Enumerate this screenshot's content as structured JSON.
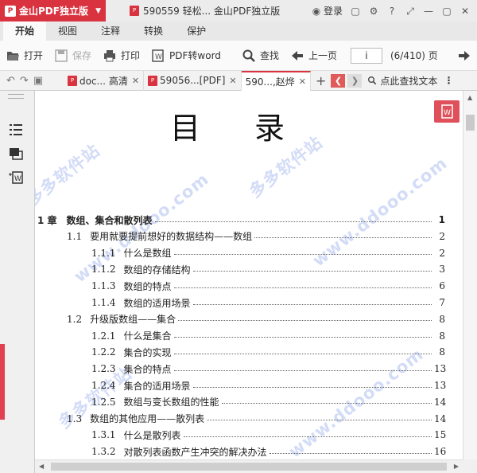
{
  "app": {
    "brand": "金山PDF独立版"
  },
  "window": {
    "title": "590559 轻松... 金山PDF独立版",
    "login": "登录"
  },
  "ribbon": {
    "tabs": [
      "开始",
      "视图",
      "注释",
      "转换",
      "保护"
    ]
  },
  "toolbar": {
    "open": "打开",
    "save": "保存",
    "print": "打印",
    "to_word": "PDF转word",
    "find": "查找",
    "prev_page": "上一页",
    "page_value": "i",
    "page_count": "(6/410)",
    "page_unit": "页"
  },
  "doc_tabs": [
    {
      "label": "doc... 高清"
    },
    {
      "label": "59056...[PDF]"
    },
    {
      "label": "590...,赵烨"
    }
  ],
  "find_text": "点此查找文本",
  "document": {
    "heading": "目录",
    "entries": [
      {
        "num": "1 章",
        "title": "数组、集合和散列表",
        "page": "1",
        "level": 0
      },
      {
        "num": "1.1",
        "title": "要用就要提前想好的数据结构——数组",
        "page": "2",
        "level": 1
      },
      {
        "num": "1.1.1",
        "title": "什么是数组",
        "page": "2",
        "level": 2
      },
      {
        "num": "1.1.2",
        "title": "数组的存储结构",
        "page": "3",
        "level": 2
      },
      {
        "num": "1.1.3",
        "title": "数组的特点",
        "page": "6",
        "level": 2
      },
      {
        "num": "1.1.4",
        "title": "数组的适用场景",
        "page": "7",
        "level": 2
      },
      {
        "num": "1.2",
        "title": "升级版数组——集合",
        "page": "8",
        "level": 1
      },
      {
        "num": "1.2.1",
        "title": "什么是集合",
        "page": "8",
        "level": 2
      },
      {
        "num": "1.2.2",
        "title": "集合的实现",
        "page": "8",
        "level": 2
      },
      {
        "num": "1.2.3",
        "title": "集合的特点",
        "page": "13",
        "level": 2
      },
      {
        "num": "1.2.4",
        "title": "集合的适用场景",
        "page": "13",
        "level": 2
      },
      {
        "num": "1.2.5",
        "title": "数组与变长数组的性能",
        "page": "14",
        "level": 2
      },
      {
        "num": "1.3",
        "title": "数组的其他应用——散列表",
        "page": "14",
        "level": 1
      },
      {
        "num": "1.3.1",
        "title": "什么是散列表",
        "page": "15",
        "level": 2
      },
      {
        "num": "1.3.2",
        "title": "对散列表函数产生冲突的解决办法",
        "page": "16",
        "level": 2
      }
    ]
  },
  "watermarks": [
    "www.ddooo.com",
    "多多软件站"
  ]
}
